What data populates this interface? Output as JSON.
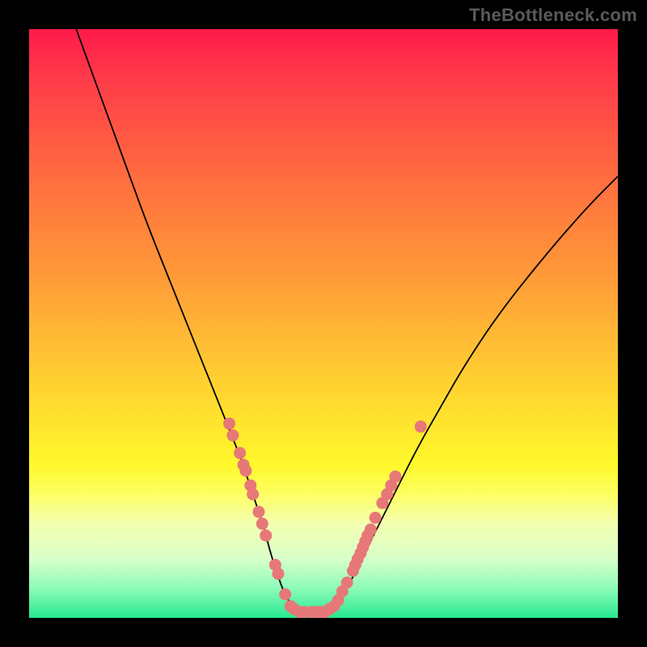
{
  "watermark": "TheBottleneck.com",
  "chart_data": {
    "type": "line",
    "title": "",
    "xlabel": "",
    "ylabel": "",
    "xlim": [
      0,
      100
    ],
    "ylim": [
      0,
      100
    ],
    "grid": false,
    "legend": false,
    "series": [
      {
        "name": "curve",
        "x": [
          8,
          12,
          16,
          20,
          24,
          28,
          32,
          34,
          36,
          38,
          39,
          40,
          41,
          42,
          43,
          44,
          45,
          46,
          47,
          48,
          50,
          52,
          54,
          56,
          58,
          62,
          66,
          70,
          74,
          80,
          88,
          95,
          100
        ],
        "y": [
          100,
          89,
          78,
          67,
          57,
          47,
          37,
          32,
          27,
          21,
          18,
          15,
          11,
          8,
          5,
          3,
          1.5,
          1,
          1,
          1,
          1,
          2,
          5,
          9,
          13,
          21,
          29,
          36,
          43,
          52,
          62,
          70,
          75
        ]
      }
    ],
    "data_points_highlighted": [
      {
        "x": 34.0,
        "y": 33
      },
      {
        "x": 34.6,
        "y": 31
      },
      {
        "x": 35.8,
        "y": 28
      },
      {
        "x": 36.4,
        "y": 26
      },
      {
        "x": 36.8,
        "y": 25
      },
      {
        "x": 37.6,
        "y": 22.5
      },
      {
        "x": 38.0,
        "y": 21
      },
      {
        "x": 39.0,
        "y": 18
      },
      {
        "x": 39.6,
        "y": 16
      },
      {
        "x": 40.2,
        "y": 14
      },
      {
        "x": 41.8,
        "y": 9
      },
      {
        "x": 42.3,
        "y": 7.5
      },
      {
        "x": 43.5,
        "y": 4
      },
      {
        "x": 44.4,
        "y": 2
      },
      {
        "x": 45.0,
        "y": 1.5
      },
      {
        "x": 46.0,
        "y": 1
      },
      {
        "x": 46.8,
        "y": 1
      },
      {
        "x": 48.0,
        "y": 1
      },
      {
        "x": 48.8,
        "y": 1
      },
      {
        "x": 49.5,
        "y": 1
      },
      {
        "x": 50.2,
        "y": 1
      },
      {
        "x": 51.0,
        "y": 1.5
      },
      {
        "x": 51.8,
        "y": 2
      },
      {
        "x": 52.5,
        "y": 3
      },
      {
        "x": 53.2,
        "y": 4.5
      },
      {
        "x": 54.0,
        "y": 6
      },
      {
        "x": 55.0,
        "y": 8
      },
      {
        "x": 55.4,
        "y": 9
      },
      {
        "x": 55.8,
        "y": 10
      },
      {
        "x": 56.3,
        "y": 11
      },
      {
        "x": 56.7,
        "y": 12
      },
      {
        "x": 57.1,
        "y": 13
      },
      {
        "x": 57.5,
        "y": 14
      },
      {
        "x": 58.0,
        "y": 15
      },
      {
        "x": 58.8,
        "y": 17
      },
      {
        "x": 60.0,
        "y": 19.5
      },
      {
        "x": 60.8,
        "y": 21
      },
      {
        "x": 61.5,
        "y": 22.5
      },
      {
        "x": 62.2,
        "y": 24
      },
      {
        "x": 66.5,
        "y": 32.5
      }
    ]
  }
}
